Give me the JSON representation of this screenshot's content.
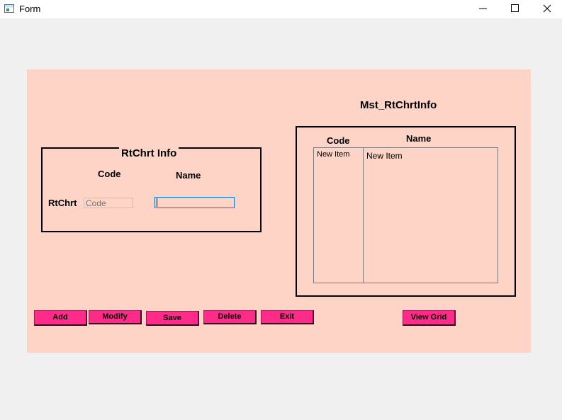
{
  "window": {
    "title": "Form",
    "controls": {
      "minimize_icon": "minimize-icon",
      "maximize_icon": "maximize-icon",
      "close_icon": "close-icon"
    }
  },
  "form": {
    "group_title": "RtChrt Info",
    "code_header": "Code",
    "name_header": "Name",
    "row_label": "RtChrt",
    "code_input": {
      "value": "",
      "placeholder": "Code"
    },
    "name_input": {
      "value": "",
      "placeholder": ""
    }
  },
  "grid": {
    "title": "Mst_RtChrtInfo",
    "columns": [
      "Code",
      "Name"
    ],
    "rows": [
      {
        "code": "New Item",
        "name": "New Item"
      }
    ]
  },
  "buttons": {
    "add": "Add",
    "modify": "Modify",
    "save": "Save",
    "delete": "Delete",
    "exit": "Exit",
    "view_grid": "View Grid"
  },
  "colors": {
    "panel_background": "#fdd4c6",
    "button_background": "#ff2b88",
    "window_background": "#f0f0f0"
  }
}
